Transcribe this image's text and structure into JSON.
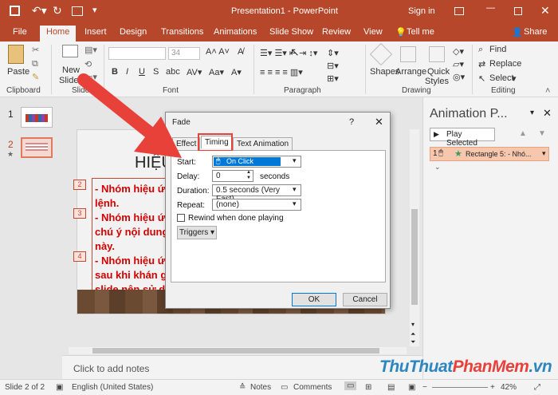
{
  "titlebar": {
    "doc_title": "Presentation1  -  PowerPoint",
    "sign_in": "Sign in"
  },
  "tabs": [
    "File",
    "Home",
    "Insert",
    "Design",
    "Transitions",
    "Animations",
    "Slide Show",
    "Review",
    "View",
    "Tell me"
  ],
  "share": "Share",
  "ribbon": {
    "paste": "Paste",
    "new_slide_1": "New",
    "new_slide_2": "Slide",
    "font_size": "34",
    "shapes": "Shapes",
    "arrange": "Arrange",
    "quick_styles_1": "Quick",
    "quick_styles_2": "Styles",
    "find": "Find",
    "replace": "Replace",
    "select": "Select",
    "groups": [
      "Clipboard",
      "Slides",
      "Font",
      "Paragraph",
      "Drawing",
      "Editing"
    ]
  },
  "thumbnails": [
    {
      "num": "1"
    },
    {
      "num": "2"
    }
  ],
  "slide": {
    "title_partial": "HIỆU",
    "lines": [
      "- Nhóm hiệu ứ",
      "lệnh.",
      "- Nhóm hiệu ứ",
      "chú ý nội dung",
      "này.",
      "- Nhóm hiệu ứ",
      "sau khi khán giả",
      "slide nên sử dụ"
    ],
    "markers": [
      "2",
      "3",
      "4"
    ]
  },
  "notes": "Click to add notes",
  "status": {
    "slide": "Slide 2 of 2",
    "language": "English (United States)",
    "notes": "Notes",
    "comments": "Comments",
    "zoom": "42%"
  },
  "anim_pane": {
    "title": "Animation P...",
    "play_selected": "Play Selected",
    "item_num": "1",
    "item_label": "Rectangle 5: - Nhó..."
  },
  "dialog": {
    "title": "Fade",
    "help": "?",
    "tabs": [
      "Effect",
      "Timing",
      "Text Animation"
    ],
    "start_label": "Start:",
    "start_value": "On Click",
    "delay_label": "Delay:",
    "delay_value": "0",
    "delay_unit": "seconds",
    "duration_label": "Duration:",
    "duration_value": "0.5 seconds (Very Fast)",
    "repeat_label": "Repeat:",
    "repeat_value": "(none)",
    "rewind_label": "Rewind when done playing",
    "triggers": "Triggers",
    "ok": "OK",
    "cancel": "Cancel"
  },
  "watermark": {
    "part1": "ThuThuat",
    "part2": "PhanMem",
    "part3": ".vn"
  },
  "colors": {
    "accent": "#b7472a",
    "slide_text": "#d20000",
    "selection": "#0078d7",
    "arrow": "#e8413a"
  }
}
